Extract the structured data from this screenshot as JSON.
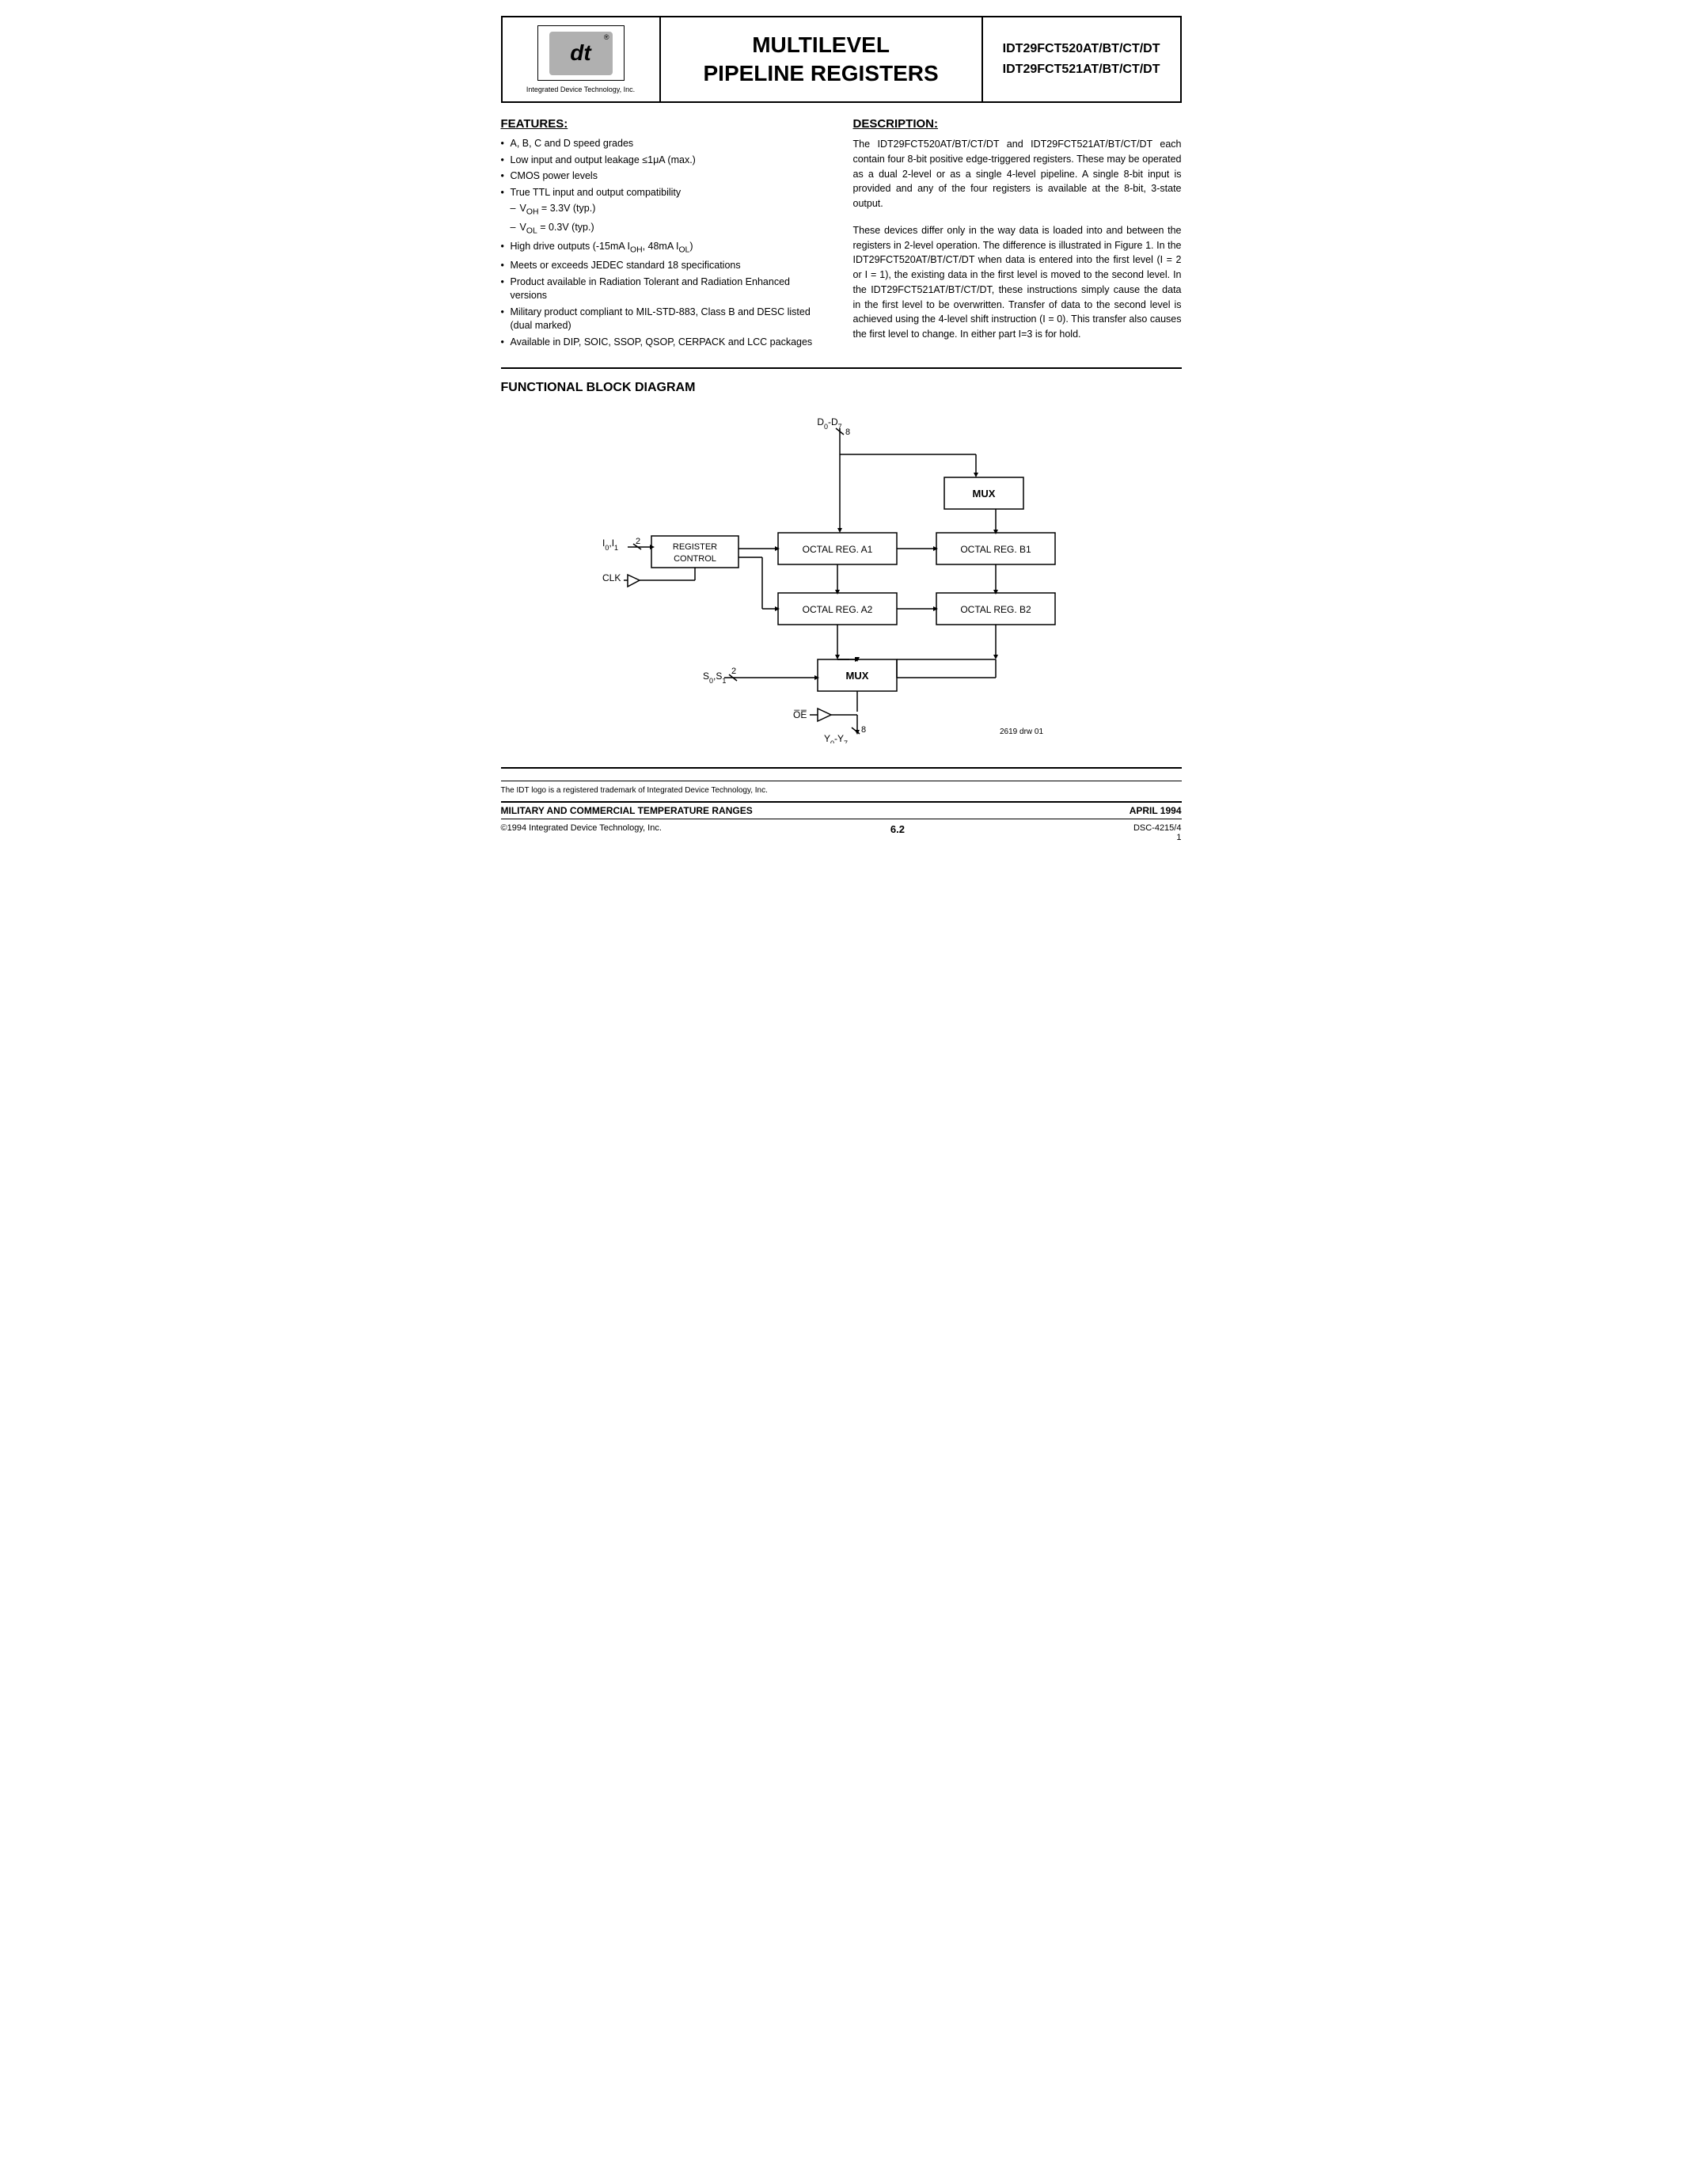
{
  "header": {
    "logo_tagline": "Integrated Device Technology, Inc.",
    "logo_symbol": "dt",
    "title_line1": "MULTILEVEL",
    "title_line2": "PIPELINE REGISTERS",
    "part_line1": "IDT29FCT520AT/BT/CT/DT",
    "part_line2": "IDT29FCT521AT/BT/CT/DT"
  },
  "features": {
    "section_title": "FEATURES:",
    "items": [
      {
        "text": "A, B, C and D speed grades",
        "indent": false
      },
      {
        "text": "Low input and output leakage ≤1μA (max.)",
        "indent": false
      },
      {
        "text": "CMOS power levels",
        "indent": false
      },
      {
        "text": "True TTL input and output compatibility",
        "indent": false
      },
      {
        "text": "– VOH = 3.3V (typ.)",
        "indent": true
      },
      {
        "text": "– VOL = 0.3V (typ.)",
        "indent": true
      },
      {
        "text": "High drive outputs (-15mA IOH, 48mA IOL)",
        "indent": false
      },
      {
        "text": "Meets or exceeds JEDEC standard 18 specifications",
        "indent": false
      },
      {
        "text": "Product available in Radiation Tolerant and Radiation Enhanced versions",
        "indent": false
      },
      {
        "text": "Military product compliant to MIL-STD-883, Class B and DESC listed (dual marked)",
        "indent": false
      },
      {
        "text": "Available in DIP, SOIC, SSOP, QSOP, CERPACK and LCC packages",
        "indent": false
      }
    ]
  },
  "description": {
    "section_title": "DESCRIPTION:",
    "text": "The IDT29FCT520AT/BT/CT/DT and IDT29FCT521AT/BT/CT/DT each contain four 8-bit positive edge-triggered registers. These may be operated as a dual 2-level or as a single 4-level pipeline. A single 8-bit input is provided and any of the four registers is available at the 8-bit, 3-state output.\n\nThese devices differ only in the way data is loaded into and between the registers in 2-level operation. The difference is illustrated in Figure 1. In the IDT29FCT520AT/BT/CT/DT when data is entered into the first level (I = 2 or I = 1), the existing data in the first level is moved to the second level. In the IDT29FCT521AT/BT/CT/DT, these instructions simply cause the data in the first level to be overwritten. Transfer of data to the second level is achieved using the 4-level shift instruction (I = 0). This transfer also causes the first level to change. In either part I=3 is for hold."
  },
  "diagram": {
    "section_title": "FUNCTIONAL BLOCK DIAGRAM",
    "labels": {
      "d0_d7": "D0-D7",
      "io_i1": "I0,I1",
      "clk": "CLK",
      "s0_s1": "S0,S1",
      "oe": "OE",
      "y0_y7": "Y0-Y7",
      "mux_top": "MUX",
      "mux_bottom": "MUX",
      "reg_control": "REGISTER\nCONTROL",
      "octal_a1": "OCTAL REG. A1",
      "octal_a2": "OCTAL REG. A2",
      "octal_b1": "OCTAL REG. B1",
      "octal_b2": "OCTAL REG. B2",
      "drawing_num": "2619 drw 01",
      "bus_8_top": "8",
      "bus_8_bottom": "8",
      "bus_2_io": "2",
      "bus_2_s": "2"
    }
  },
  "footer": {
    "trademark_text": "The IDT logo is a registered trademark of Integrated Device Technology, Inc.",
    "bar_title": "MILITARY AND COMMERCIAL TEMPERATURE RANGES",
    "bar_date": "APRIL 1994",
    "copyright": "©1994 Integrated Device Technology, Inc.",
    "page_number": "6.2",
    "doc_number": "DSC-4215/4",
    "page_num_right": "1"
  }
}
